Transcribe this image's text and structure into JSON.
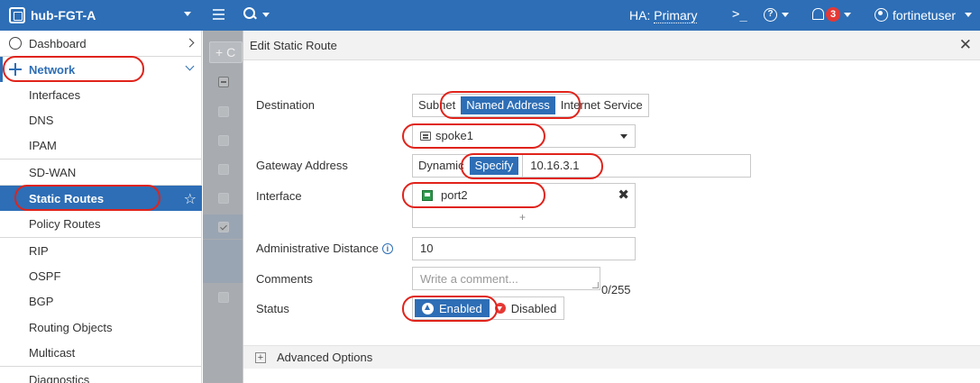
{
  "topbar": {
    "device_name": "hub-FGT-A",
    "ha_label": "HA:",
    "ha_value": "Primary",
    "cli_symbol": ">_",
    "help_symbol": "?",
    "notification_count": "3",
    "username": "fortinetuser"
  },
  "sidebar": {
    "items": [
      {
        "label": "Dashboard"
      },
      {
        "label": "Network"
      },
      {
        "label": "Interfaces"
      },
      {
        "label": "DNS"
      },
      {
        "label": "IPAM"
      },
      {
        "label": "SD-WAN"
      },
      {
        "label": "Static Routes"
      },
      {
        "label": "Policy Routes"
      },
      {
        "label": "RIP"
      },
      {
        "label": "OSPF"
      },
      {
        "label": "BGP"
      },
      {
        "label": "Routing Objects"
      },
      {
        "label": "Multicast"
      },
      {
        "label": "Diagnostics"
      }
    ]
  },
  "background": {
    "create_button": "+ C"
  },
  "dialog": {
    "title": "Edit Static Route",
    "close_symbol": "✕",
    "destination_label": "Destination",
    "destination_options": [
      "Subnet",
      "Named Address",
      "Internet Service"
    ],
    "destination_selected": "Named Address",
    "named_address_value": "spoke1",
    "gateway_label": "Gateway Address",
    "gateway_options": [
      "Dynamic",
      "Specify"
    ],
    "gateway_selected": "Specify",
    "gateway_value": "10.16.3.1",
    "interface_label": "Interface",
    "interface_value": "port2",
    "interface_remove_symbol": "✖",
    "interface_add_symbol": "+",
    "admin_distance_label": "Administrative Distance",
    "admin_distance_value": "10",
    "comments_label": "Comments",
    "comments_placeholder": "Write a comment...",
    "comments_count": "0/255",
    "status_label": "Status",
    "status_enabled": "Enabled",
    "status_disabled": "Disabled",
    "advanced_label": "Advanced Options"
  },
  "colors": {
    "brand_blue": "#2d6eb6",
    "annotation_red": "#e0231b"
  }
}
